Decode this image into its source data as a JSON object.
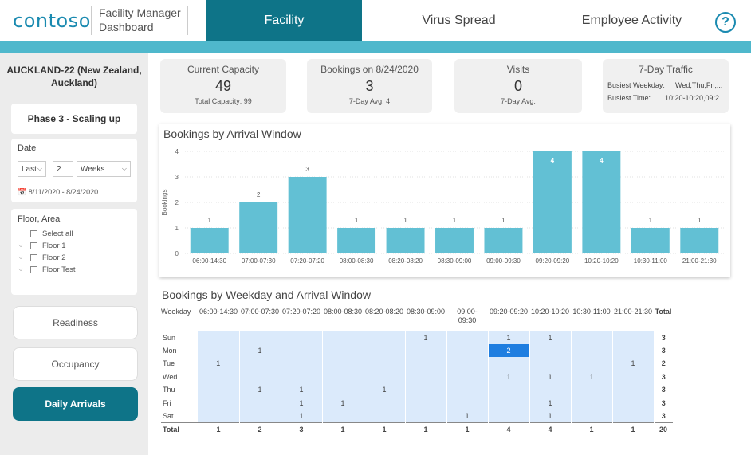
{
  "header": {
    "logo": "contoso",
    "title_line1": "Facility Manager",
    "title_line2": "Dashboard",
    "tabs": [
      {
        "label": "Facility",
        "active": true
      },
      {
        "label": "Virus Spread",
        "active": false
      },
      {
        "label": "Employee Activity",
        "active": false
      }
    ],
    "help_label": "?",
    "accent": "#0e7488",
    "bar_color": "#4fb8cc"
  },
  "sidebar": {
    "site_line1": "AUCKLAND-22 (New Zealand,",
    "site_line2": "Auckland)",
    "phase": "Phase 3 - Scaling up",
    "date": {
      "label": "Date",
      "mode": "Last",
      "count": "2",
      "unit": "Weeks",
      "range": "8/11/2020 - 8/24/2020"
    },
    "floor": {
      "label": "Floor, Area",
      "items": [
        "Select all",
        "Floor 1",
        "Floor 2",
        "Floor Test"
      ]
    },
    "nav": [
      {
        "label": "Readiness",
        "active": false
      },
      {
        "label": "Occupancy",
        "active": false
      },
      {
        "label": "Daily Arrivals",
        "active": true
      }
    ]
  },
  "kpis": {
    "capacity": {
      "title": "Current Capacity",
      "value": "49",
      "sub": "Total Capacity: 99"
    },
    "bookings": {
      "title": "Bookings on 8/24/2020",
      "value": "3",
      "sub": "7-Day Avg: 4"
    },
    "visits": {
      "title": "Visits",
      "value": "0",
      "sub": "7-Day Avg:"
    },
    "traffic": {
      "title": "7-Day Traffic",
      "weekday_label": "Busiest Weekday:",
      "weekday_value": "Wed,Thu,Fri,...",
      "time_label": "Busiest Time:",
      "time_value": "10:20-10:20,09:2..."
    }
  },
  "chart_data": {
    "type": "bar",
    "title": "Bookings by Arrival Window",
    "ylabel": "Bookings",
    "xlabel": "",
    "ylim": [
      0,
      4
    ],
    "yticks": [
      0,
      1,
      2,
      3,
      4
    ],
    "categories": [
      "06:00-14:30",
      "07:00-07:30",
      "07:20-07:20",
      "08:00-08:30",
      "08:20-08:20",
      "08:30-09:00",
      "09:00-09:30",
      "09:20-09:20",
      "10:20-10:20",
      "10:30-11:00",
      "21:00-21:30"
    ],
    "values": [
      1,
      2,
      3,
      1,
      1,
      1,
      1,
      4,
      4,
      1,
      1
    ],
    "bar_color": "#62c0d4",
    "highlight_color": "#4fb8cc",
    "grid": true,
    "legend": "none"
  },
  "table": {
    "title": "Bookings by Weekday and Arrival Window",
    "corner": "Weekday",
    "columns": [
      "06:00-14:30",
      "07:00-07:30",
      "07:20-07:20",
      "08:00-08:30",
      "08:20-08:20",
      "08:30-09:00",
      "09:00-\n09:30",
      "09:20-09:20",
      "10:20-10:20",
      "10:30-11:00",
      "21:00-21:30"
    ],
    "total_label": "Total",
    "rows": [
      {
        "day": "Sun",
        "cells": [
          "",
          "",
          "",
          "",
          "",
          "1",
          "",
          "1",
          "1",
          "",
          ""
        ],
        "total": "3"
      },
      {
        "day": "Mon",
        "cells": [
          "",
          "1",
          "",
          "",
          "",
          "",
          "",
          "2",
          "",
          "",
          ""
        ],
        "total": "3"
      },
      {
        "day": "Tue",
        "cells": [
          "1",
          "",
          "",
          "",
          "",
          "",
          "",
          "",
          "",
          "",
          "1"
        ],
        "total": "2"
      },
      {
        "day": "Wed",
        "cells": [
          "",
          "",
          "",
          "",
          "",
          "",
          "",
          "1",
          "1",
          "1",
          ""
        ],
        "total": "3"
      },
      {
        "day": "Thu",
        "cells": [
          "",
          "1",
          "1",
          "",
          "1",
          "",
          "",
          "",
          "",
          "",
          ""
        ],
        "total": "3"
      },
      {
        "day": "Fri",
        "cells": [
          "",
          "",
          "1",
          "1",
          "",
          "",
          "",
          "",
          "1",
          "",
          ""
        ],
        "total": "3"
      },
      {
        "day": "Sat",
        "cells": [
          "",
          "",
          "1",
          "",
          "",
          "",
          "1",
          "",
          "1",
          "",
          ""
        ],
        "total": "3"
      }
    ],
    "totals": [
      "1",
      "2",
      "3",
      "1",
      "1",
      "1",
      "1",
      "4",
      "4",
      "1",
      "1"
    ],
    "grand_total": "20",
    "hot_cell": {
      "row": 1,
      "col": 7
    }
  }
}
